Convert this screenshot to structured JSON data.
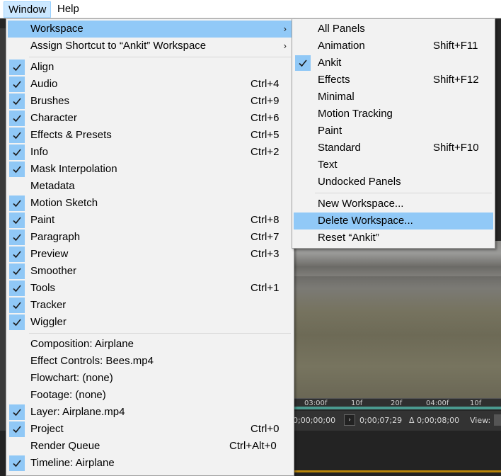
{
  "menubar": {
    "items": [
      {
        "label": "Window",
        "active": true
      },
      {
        "label": "Help",
        "active": false
      }
    ]
  },
  "background": {
    "ruler_ticks": [
      "03:00f",
      "10f",
      "20f",
      "04:00f",
      "10f"
    ],
    "timecodes": [
      "0;00;00;00",
      "0;00;07;29",
      "Δ 0;00;08;00"
    ],
    "view_label": "View:"
  },
  "window_menu": {
    "top": [
      {
        "label": "Workspace",
        "submenu": true,
        "highlighted": true
      },
      {
        "label": "Assign Shortcut to “Ankit” Workspace",
        "submenu": true
      }
    ],
    "panels": [
      {
        "label": "Align",
        "checked": true,
        "shortcut": ""
      },
      {
        "label": "Audio",
        "checked": true,
        "shortcut": "Ctrl+4"
      },
      {
        "label": "Brushes",
        "checked": true,
        "shortcut": "Ctrl+9"
      },
      {
        "label": "Character",
        "checked": true,
        "shortcut": "Ctrl+6"
      },
      {
        "label": "Effects & Presets",
        "checked": true,
        "shortcut": "Ctrl+5"
      },
      {
        "label": "Info",
        "checked": true,
        "shortcut": "Ctrl+2"
      },
      {
        "label": "Mask Interpolation",
        "checked": true,
        "shortcut": ""
      },
      {
        "label": "Metadata",
        "checked": false,
        "shortcut": ""
      },
      {
        "label": "Motion Sketch",
        "checked": true,
        "shortcut": ""
      },
      {
        "label": "Paint",
        "checked": true,
        "shortcut": "Ctrl+8"
      },
      {
        "label": "Paragraph",
        "checked": true,
        "shortcut": "Ctrl+7"
      },
      {
        "label": "Preview",
        "checked": true,
        "shortcut": "Ctrl+3"
      },
      {
        "label": "Smoother",
        "checked": true,
        "shortcut": ""
      },
      {
        "label": "Tools",
        "checked": true,
        "shortcut": "Ctrl+1"
      },
      {
        "label": "Tracker",
        "checked": true,
        "shortcut": ""
      },
      {
        "label": "Wiggler",
        "checked": true,
        "shortcut": ""
      }
    ],
    "viewers": [
      {
        "label": "Composition: Airplane",
        "checked": false,
        "shortcut": ""
      },
      {
        "label": "Effect Controls: Bees.mp4",
        "checked": false,
        "shortcut": ""
      },
      {
        "label": "Flowchart: (none)",
        "checked": false,
        "shortcut": ""
      },
      {
        "label": "Footage: (none)",
        "checked": false,
        "shortcut": ""
      },
      {
        "label": "Layer: Airplane.mp4",
        "checked": true,
        "shortcut": ""
      },
      {
        "label": "Project",
        "checked": true,
        "shortcut": "Ctrl+0"
      },
      {
        "label": "Render Queue",
        "checked": false,
        "shortcut": "Ctrl+Alt+0"
      },
      {
        "label": "Timeline: Airplane",
        "checked": true,
        "shortcut": ""
      }
    ]
  },
  "workspace_submenu": {
    "workspaces": [
      {
        "label": "All Panels",
        "checked": false,
        "shortcut": ""
      },
      {
        "label": "Animation",
        "checked": false,
        "shortcut": "Shift+F11"
      },
      {
        "label": "Ankit",
        "checked": true,
        "shortcut": ""
      },
      {
        "label": "Effects",
        "checked": false,
        "shortcut": "Shift+F12"
      },
      {
        "label": "Minimal",
        "checked": false,
        "shortcut": ""
      },
      {
        "label": "Motion Tracking",
        "checked": false,
        "shortcut": ""
      },
      {
        "label": "Paint",
        "checked": false,
        "shortcut": ""
      },
      {
        "label": "Standard",
        "checked": false,
        "shortcut": "Shift+F10"
      },
      {
        "label": "Text",
        "checked": false,
        "shortcut": ""
      },
      {
        "label": "Undocked Panels",
        "checked": false,
        "shortcut": ""
      }
    ],
    "actions": [
      {
        "label": "New Workspace...",
        "highlighted": false
      },
      {
        "label": "Delete Workspace...",
        "highlighted": true
      },
      {
        "label": "Reset “Ankit”",
        "highlighted": false
      }
    ]
  },
  "colors": {
    "highlight": "#91c9f7",
    "check_bg": "#90c8f6",
    "menu_bg": "#f2f2f2"
  },
  "icons": {
    "check": "check-icon",
    "submenu_arrow": "chevron-right-icon"
  }
}
